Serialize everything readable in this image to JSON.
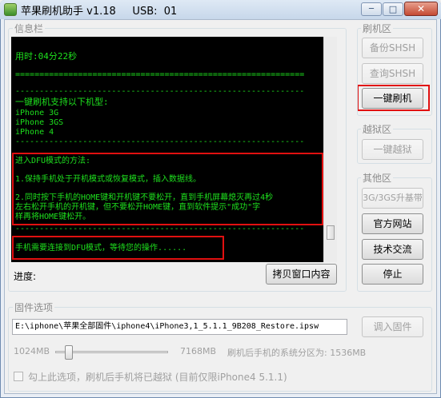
{
  "window": {
    "title": "苹果刷机助手 v1.18     USB:  01",
    "min_glyph": "─",
    "max_glyph": "□",
    "close_glyph": "✕"
  },
  "info_group": {
    "label": "信息栏"
  },
  "console": {
    "lines": [
      "用时:04分22秒",
      "============================================================",
      "------------------------------------------------------------",
      "一键刷机支持以下机型:",
      "iPhone 3G",
      "iPhone 3GS",
      "iPhone 4",
      "------------------------------------------------------------",
      "进入DFU模式的方法:",
      "1.保持手机处于开机模式或恢复模式，插入数据线。",
      "2.同时按下手机的HOME键和开机键不要松开，直到手机屏幕熄灭再过4秒",
      "左右松开手机的开机键，但不要松开HOME键，直到软件提示\"成功\"字",
      "样再将HOME键松开。",
      "------------------------------------------------------------",
      "手机需要连接到DFU模式，等待您的操作......"
    ]
  },
  "progress": {
    "label": "进度:"
  },
  "copy_button": "拷贝窗口内容",
  "flash_group": {
    "label": "刷机区",
    "backup": "备份SHSH",
    "query": "查询SHSH",
    "one_click_flash": "一键刷机"
  },
  "jailbreak_group": {
    "label": "越狱区",
    "one_click_jailbreak": "一键越狱"
  },
  "other_group": {
    "label": "其他区",
    "upgrade_3g": "3G/3GS升基带",
    "official_site": "官方网站",
    "tech_talk": "技术交流",
    "stop": "停止"
  },
  "firmware_group": {
    "label": "固件选项",
    "path": "E:\\iphone\\苹果全部固件\\iphone4\\iPhone3,1_5.1.1_9B208_Restore.ipsw",
    "import": "调入固件",
    "min": "1024MB",
    "max": "7168MB",
    "partition_text": "刷机后手机的系统分区为: 1536MB",
    "slider_fraction": 0.08,
    "checkbox_label": "勾上此选项，刷机后手机将已越狱 (目前仅限iPhone4 5.1.1)"
  }
}
